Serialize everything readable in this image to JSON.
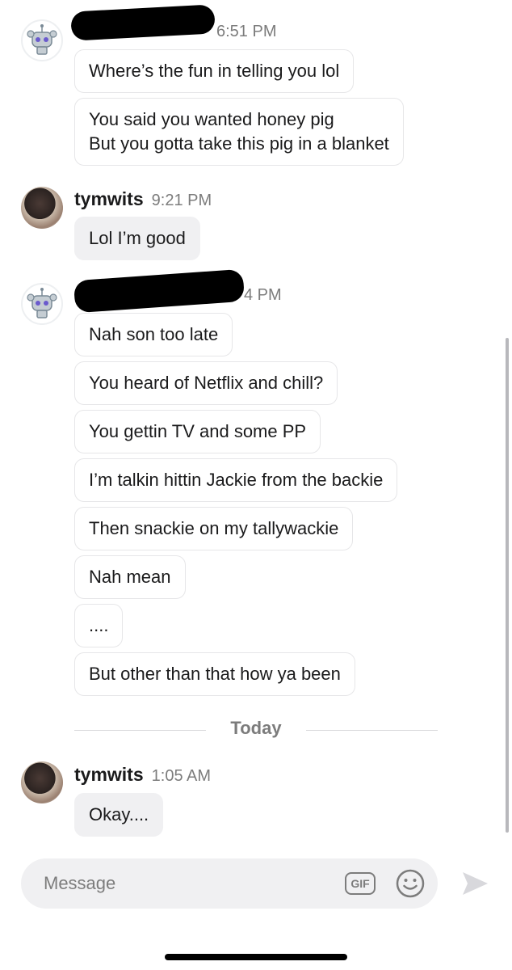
{
  "messages": [
    {
      "time": "6:51 PM",
      "bubbles": [
        "Where’s the fun in telling you lol",
        "You said you wanted honey pig|But you gotta take this pig in a blanket"
      ]
    },
    {
      "username": "tymwits",
      "time": "9:21 PM",
      "bubbles": [
        "Lol I’m good"
      ]
    },
    {
      "time": "4 PM",
      "bubbles": [
        "Nah son too late",
        "You heard of Netflix and chill?",
        "You gettin TV and some PP",
        "I’m talkin hittin Jackie from the backie",
        "Then snackie on my tallywackie",
        "Nah mean",
        "....",
        "But other than that how ya been"
      ]
    },
    {
      "username": "tymwits",
      "time": "1:05 AM",
      "bubbles": [
        "Okay...."
      ]
    }
  ],
  "divider_label": "Today",
  "composer": {
    "placeholder": "Message",
    "gif_label": "GIF"
  },
  "icons": {
    "emoji": "emoji-icon",
    "send": "send-icon",
    "bot_avatar": "snoo-robot-icon"
  }
}
